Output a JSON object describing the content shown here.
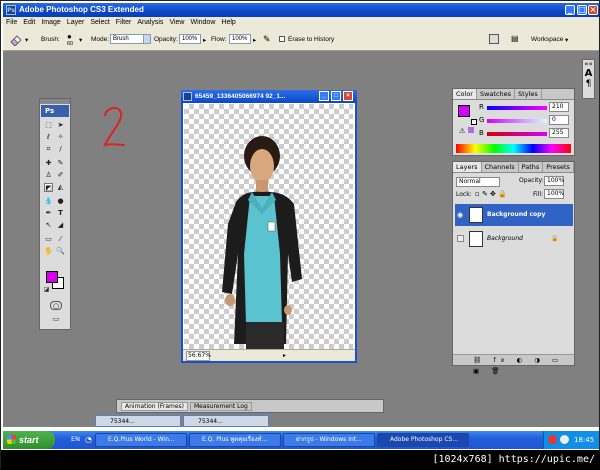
{
  "window": {
    "title": "Adobe Photoshop CS3 Extended"
  },
  "menu": [
    "File",
    "Edit",
    "Image",
    "Layer",
    "Select",
    "Filter",
    "Analysis",
    "View",
    "Window",
    "Help"
  ],
  "options_bar": {
    "brush_label": "Brush:",
    "brush_size": "60",
    "mode_label": "Mode:",
    "mode_value": "Brush",
    "opacity_label": "Opacity:",
    "opacity_value": "100%",
    "flow_label": "Flow:",
    "flow_value": "100%",
    "erase_history_label": "Erase to History",
    "workspace_label": "Workspace"
  },
  "toolbox": {
    "logo": "Ps",
    "fg_color": "#d400e8",
    "bg_color": "#ffffff"
  },
  "annotation": {
    "text": "2",
    "color": "#e02020"
  },
  "document": {
    "title": "65459_1336405066974 92_1...",
    "zoom": "56.67%"
  },
  "color_panel": {
    "tabs": [
      "Color",
      "Swatches",
      "Styles"
    ],
    "r_label": "R",
    "r_value": "210",
    "g_label": "G",
    "g_value": "0",
    "b_label": "B",
    "b_value": "255",
    "swatch_color": "#d200ff"
  },
  "layers_panel": {
    "tabs": [
      "Layers",
      "Channels",
      "Paths",
      "Presets"
    ],
    "blend_mode": "Normal",
    "opacity_label": "Opacity:",
    "opacity_value": "100%",
    "lock_label": "Lock:",
    "fill_label": "Fill:",
    "fill_value": "100%",
    "layers": [
      {
        "name": "Background copy",
        "selected": true
      },
      {
        "name": "Background",
        "selected": false
      }
    ]
  },
  "bottom_panel": {
    "tabs": [
      "Animation (Frames)",
      "Measurement Log"
    ]
  },
  "minimized_docs": [
    "75344...",
    "75344..."
  ],
  "taskbar": {
    "start_label": "start",
    "lang": "EN",
    "buttons": [
      "E.Q.Plus World - Win...",
      "E.Q. Plus พูดคุยเรื่องทั่...",
      "ฝากรูป - Windows Int...",
      "Adobe Photoshop CS..."
    ],
    "clock": "18:45"
  },
  "footer": "[1024x768] https://upic.me/"
}
